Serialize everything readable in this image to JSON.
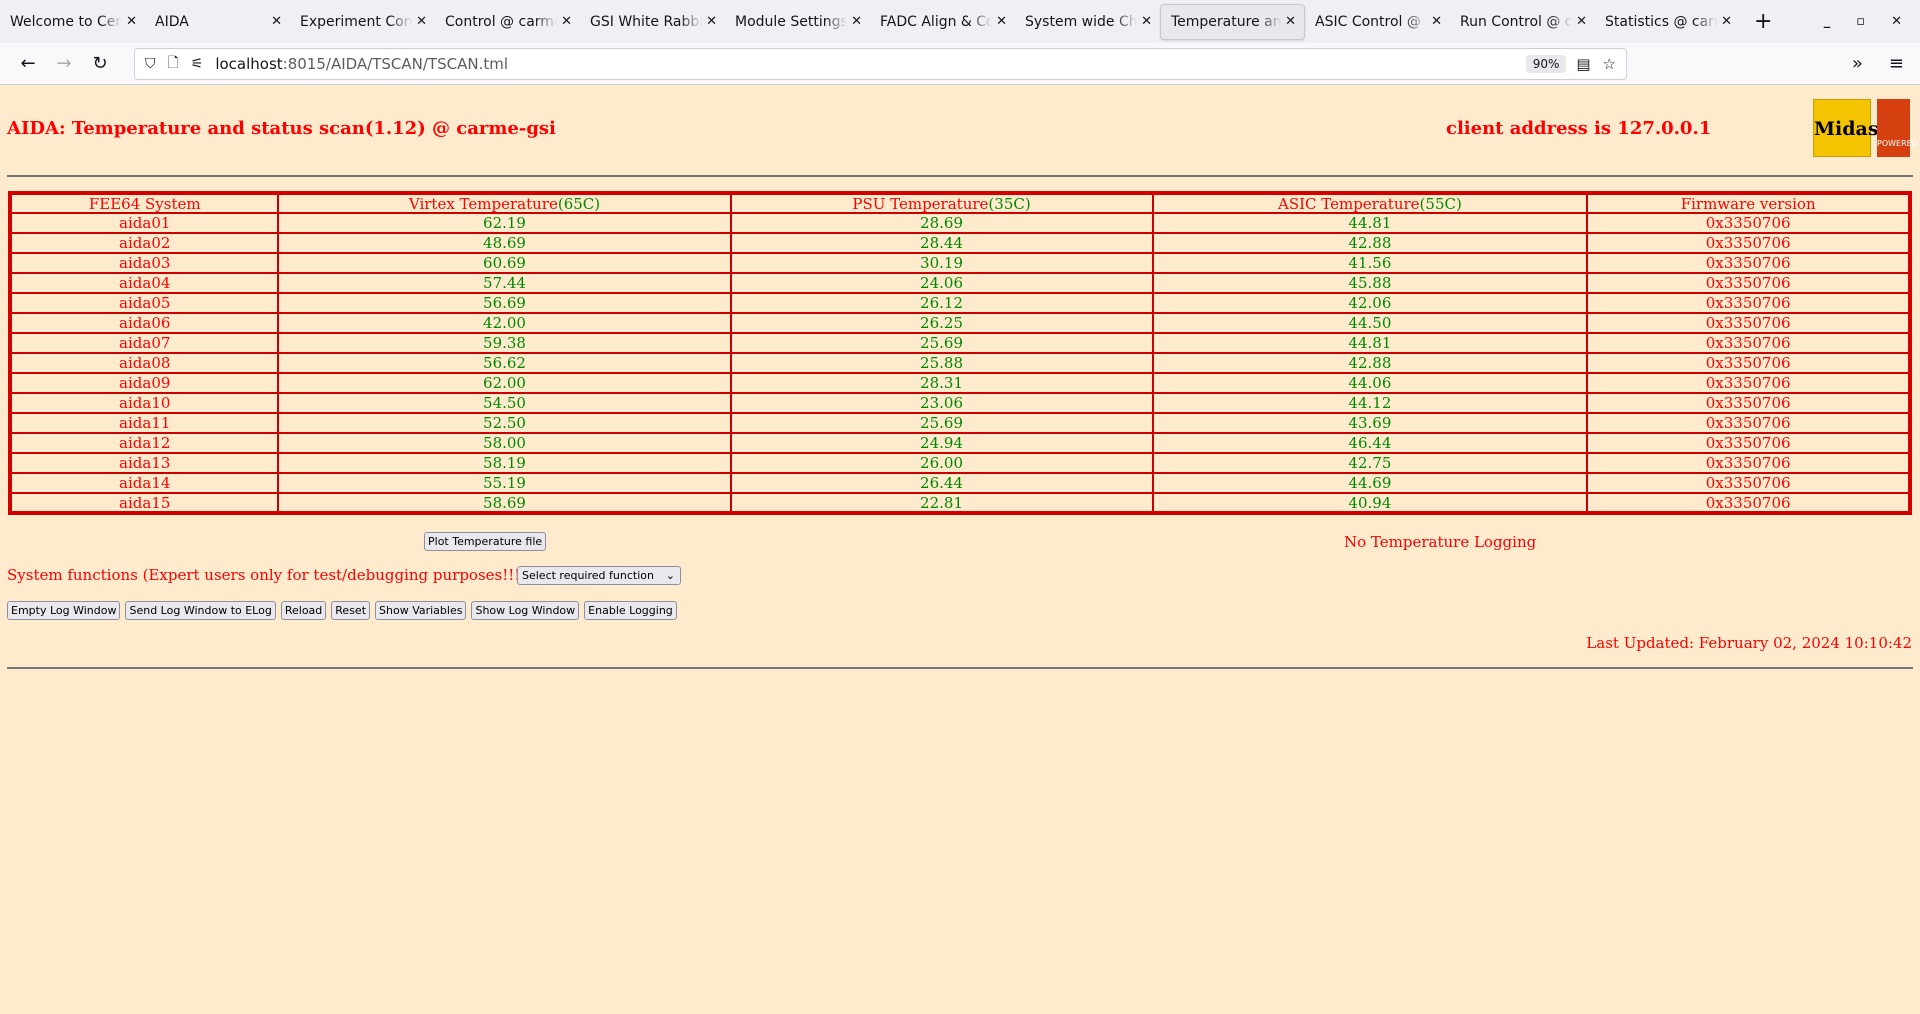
{
  "browser": {
    "tabs": [
      {
        "label": "Welcome to Cent",
        "active": false
      },
      {
        "label": "AIDA",
        "active": false
      },
      {
        "label": "Experiment Cont",
        "active": false
      },
      {
        "label": "Control @ carme",
        "active": false
      },
      {
        "label": "GSI White Rabbit",
        "active": false
      },
      {
        "label": "Module Settings",
        "active": false
      },
      {
        "label": "FADC Align & Co",
        "active": false
      },
      {
        "label": "System wide Che",
        "active": false
      },
      {
        "label": "Temperature and",
        "active": true
      },
      {
        "label": "ASIC Control @ c",
        "active": false
      },
      {
        "label": "Run Control @ ca",
        "active": false
      },
      {
        "label": "Statistics @ carm",
        "active": false
      }
    ],
    "url_host": "localhost",
    "url_path": ":8015/AIDA/TSCAN/TSCAN.tml",
    "zoom": "90%"
  },
  "header": {
    "title": "AIDA: Temperature and status scan(1.12) @ carme-gsi",
    "client": "client address is 127.0.0.1",
    "logo_midas": "Midas",
    "logo_tcl": "TCL POWERED"
  },
  "table": {
    "headers": {
      "system": "FEE64 System",
      "virtex": "Virtex Temperature",
      "virtex_limit": "(65C)",
      "psu": "PSU Temperature",
      "psu_limit": "(35C)",
      "asic": "ASIC Temperature",
      "asic_limit": "(55C)",
      "firmware": "Firmware version"
    },
    "rows": [
      [
        "aida01",
        "62.19",
        "28.69",
        "44.81",
        "0x3350706"
      ],
      [
        "aida02",
        "48.69",
        "28.44",
        "42.88",
        "0x3350706"
      ],
      [
        "aida03",
        "60.69",
        "30.19",
        "41.56",
        "0x3350706"
      ],
      [
        "aida04",
        "57.44",
        "24.06",
        "45.88",
        "0x3350706"
      ],
      [
        "aida05",
        "56.69",
        "26.12",
        "42.06",
        "0x3350706"
      ],
      [
        "aida06",
        "42.00",
        "26.25",
        "44.50",
        "0x3350706"
      ],
      [
        "aida07",
        "59.38",
        "25.69",
        "44.81",
        "0x3350706"
      ],
      [
        "aida08",
        "56.62",
        "25.88",
        "42.88",
        "0x3350706"
      ],
      [
        "aida09",
        "62.00",
        "28.31",
        "44.06",
        "0x3350706"
      ],
      [
        "aida10",
        "54.50",
        "23.06",
        "44.12",
        "0x3350706"
      ],
      [
        "aida11",
        "52.50",
        "25.69",
        "43.69",
        "0x3350706"
      ],
      [
        "aida12",
        "58.00",
        "24.94",
        "46.44",
        "0x3350706"
      ],
      [
        "aida13",
        "58.19",
        "26.00",
        "42.75",
        "0x3350706"
      ],
      [
        "aida14",
        "55.19",
        "26.44",
        "44.69",
        "0x3350706"
      ],
      [
        "aida15",
        "58.69",
        "22.81",
        "40.94",
        "0x3350706"
      ]
    ]
  },
  "plot_button": "Plot Temperature file",
  "logging_status": "No Temperature Logging",
  "system_functions": {
    "label": "System functions (Expert users only for test/debugging purposes!!!)",
    "select_value": "Select required function"
  },
  "buttons": [
    "Empty Log Window",
    "Send Log Window to ELog",
    "Reload",
    "Reset",
    "Show Variables",
    "Show Log Window",
    "Enable Logging"
  ],
  "last_updated": "Last Updated: February 02, 2024 10:10:42"
}
